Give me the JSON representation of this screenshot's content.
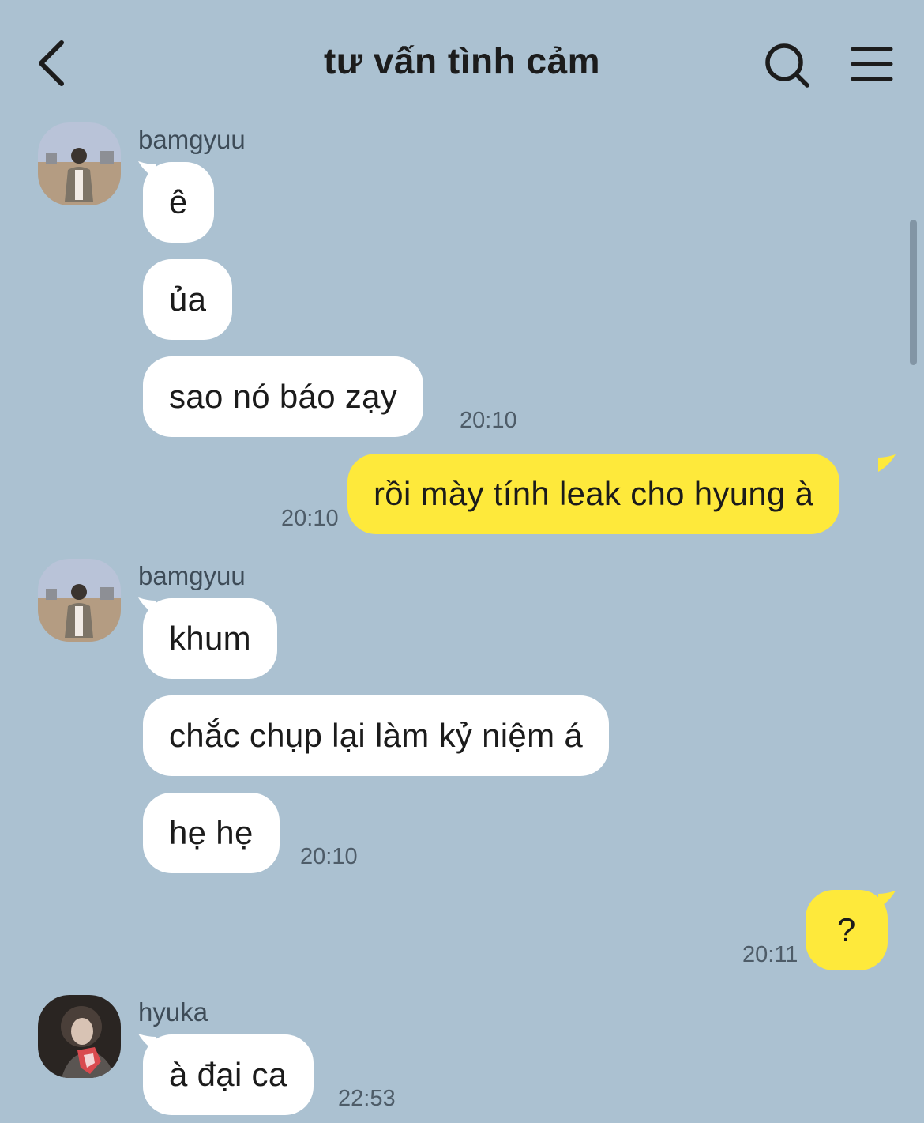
{
  "header": {
    "title": "tư vấn tình cảm",
    "back_icon": "chevron-left-icon",
    "search_icon": "search-icon",
    "menu_icon": "hamburger-menu-icon"
  },
  "colors": {
    "background": "#abc1d1",
    "incoming_bubble": "#ffffff",
    "outgoing_bubble": "#fee93b"
  },
  "messages": {
    "g1": {
      "sender": "bamgyuu",
      "m1": "ê",
      "m2": "ủa",
      "m3": "sao nó báo zạy",
      "time": "20:10"
    },
    "o1": {
      "text": "rồi mày tính leak cho hyung à",
      "time": "20:10"
    },
    "g2": {
      "sender": "bamgyuu",
      "m1": "khum",
      "m2": "chắc chụp lại làm kỷ niệm á",
      "m3": "hẹ hẹ",
      "time": "20:10"
    },
    "o2": {
      "text": "?",
      "time": "20:11"
    },
    "g3": {
      "sender": "hyuka",
      "m1": "à đại ca",
      "time": "22:53"
    }
  }
}
